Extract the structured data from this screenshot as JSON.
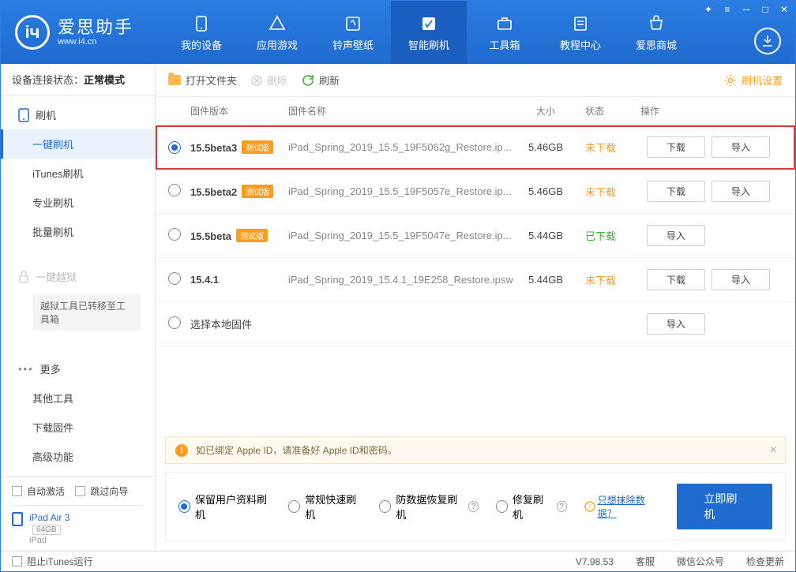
{
  "brand": {
    "main": "爱思助手",
    "sub": "www.i4.cn"
  },
  "topnav": {
    "items": [
      {
        "label": "我的设备"
      },
      {
        "label": "应用游戏"
      },
      {
        "label": "铃声壁纸"
      },
      {
        "label": "智能刷机"
      },
      {
        "label": "工具箱"
      },
      {
        "label": "教程中心"
      },
      {
        "label": "爱思商城"
      }
    ],
    "active_index": 3
  },
  "sidebar": {
    "conn_label": "设备连接状态：",
    "conn_value": "正常模式",
    "group_flash": "刷机",
    "items_flash": [
      {
        "label": "一键刷机",
        "active": true
      },
      {
        "label": "iTunes刷机"
      },
      {
        "label": "专业刷机"
      },
      {
        "label": "批量刷机"
      }
    ],
    "group_jb": "一键越狱",
    "jb_info": "越狱工具已转移至工具箱",
    "group_more": "更多",
    "items_more": [
      {
        "label": "其他工具"
      },
      {
        "label": "下载固件"
      },
      {
        "label": "高级功能"
      }
    ],
    "auto_activate": "自动激活",
    "skip_guide": "跳过向导",
    "device_name": "iPad Air 3",
    "device_storage": "64GB",
    "device_type": "iPad"
  },
  "toolbar": {
    "open_folder": "打开文件夹",
    "delete": "删除",
    "refresh": "刷新",
    "settings": "刷机设置"
  },
  "table": {
    "headers": {
      "version": "固件版本",
      "name": "固件名称",
      "size": "大小",
      "status": "状态",
      "ops": "操作"
    },
    "btn_download": "下载",
    "btn_import": "导入",
    "beta_tag": "测试版",
    "rows": [
      {
        "version": "15.5beta3",
        "beta": true,
        "name": "iPad_Spring_2019_15.5_19F5062g_Restore.ip...",
        "size": "5.46GB",
        "status": "未下载",
        "status_cls": "st-not",
        "selected": true,
        "highlight": true,
        "show_dl": true
      },
      {
        "version": "15.5beta2",
        "beta": true,
        "name": "iPad_Spring_2019_15.5_19F5057e_Restore.ip...",
        "size": "5.46GB",
        "status": "未下载",
        "status_cls": "st-not",
        "show_dl": true
      },
      {
        "version": "15.5beta",
        "beta": true,
        "name": "iPad_Spring_2019_15.5_19F5047e_Restore.ip...",
        "size": "5.44GB",
        "status": "已下载",
        "status_cls": "st-done",
        "show_dl": false
      },
      {
        "version": "15.4.1",
        "beta": false,
        "name": "iPad_Spring_2019_15.4.1_19E258_Restore.ipsw",
        "size": "5.44GB",
        "status": "未下载",
        "status_cls": "st-not",
        "show_dl": true
      }
    ],
    "local_row": "选择本地固件"
  },
  "notice": "如已绑定 Apple ID，请准备好 Apple ID和密码。",
  "action": {
    "opts": [
      {
        "label": "保留用户资料刷机",
        "selected": true,
        "q": false
      },
      {
        "label": "常规快速刷机",
        "q": false
      },
      {
        "label": "防数据恢复刷机",
        "q": true
      },
      {
        "label": "修复刷机",
        "q": true
      }
    ],
    "erase_link": "只想抹除数据？",
    "flash_btn": "立即刷机"
  },
  "statusbar": {
    "block_itunes": "阻止iTunes运行",
    "version": "V7.98.53",
    "support": "客服",
    "wechat": "微信公众号",
    "update": "检查更新"
  }
}
